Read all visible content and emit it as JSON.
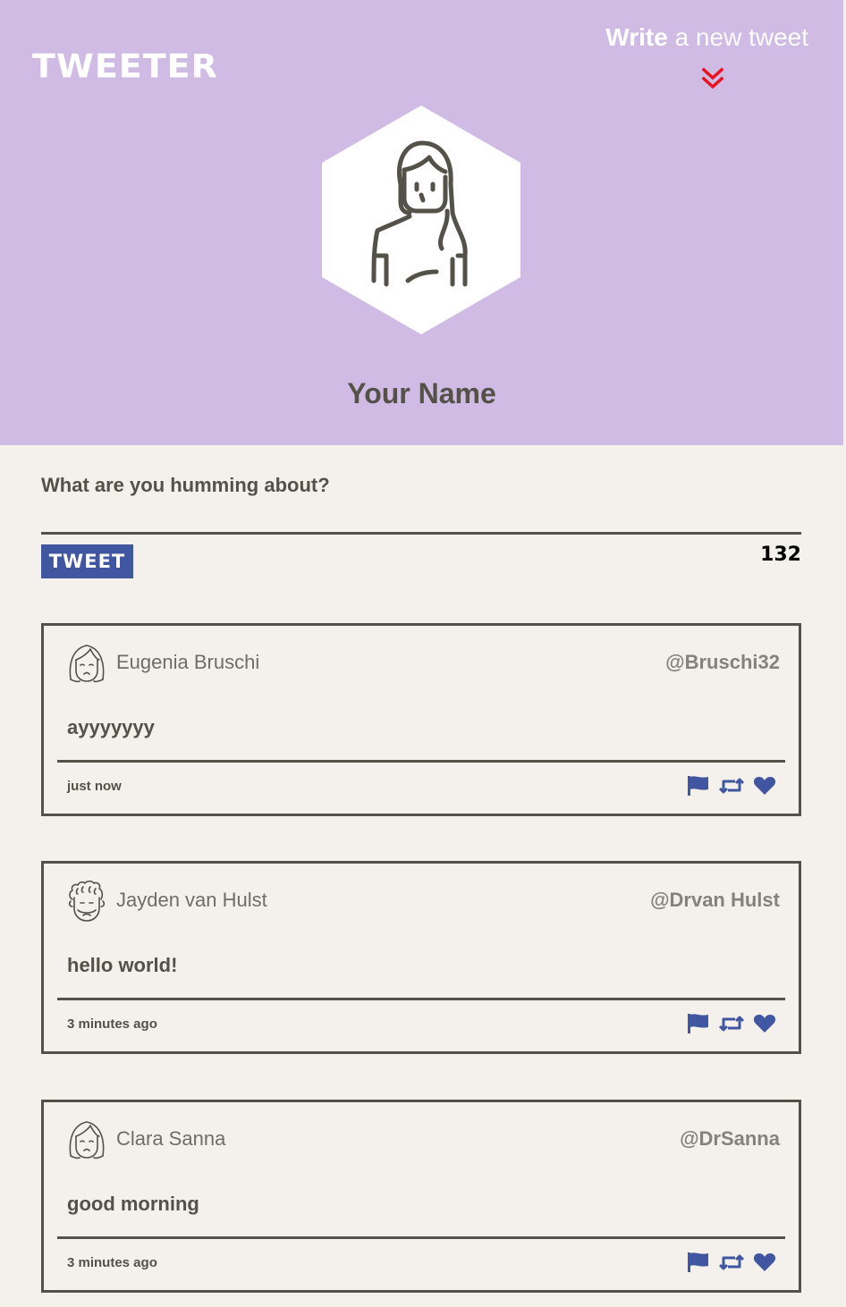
{
  "header": {
    "logo": "TWEETER",
    "compose_strong": "Write",
    "compose_light": "a new tweet",
    "chevron_icon": "double-chevron-down-icon",
    "chevron_color": "#e8131e",
    "avatar_icon": "woman-avatar-icon",
    "profile_name": "Your Name",
    "background": "#cfbbe4"
  },
  "composer": {
    "placeholder": "What are you humming about?",
    "button_label": "TWEET",
    "char_count": "132",
    "accent": "#4056a1"
  },
  "tweets": [
    {
      "avatar_icon": "woman-avatar-icon",
      "name": "Eugenia Bruschi",
      "handle": "@Bruschi32",
      "content": "ayyyyyyy",
      "time": "just now",
      "actions": [
        "flag-icon",
        "retweet-icon",
        "heart-icon"
      ]
    },
    {
      "avatar_icon": "curly-hair-man-avatar-icon",
      "name": "Jayden van Hulst",
      "handle": "@Drvan Hulst",
      "content": "hello world!",
      "time": "3 minutes ago",
      "actions": [
        "flag-icon",
        "retweet-icon",
        "heart-icon"
      ]
    },
    {
      "avatar_icon": "woman-avatar-icon",
      "name": "Clara Sanna",
      "handle": "@DrSanna",
      "content": "good morning",
      "time": "3 minutes ago",
      "actions": [
        "flag-icon",
        "retweet-icon",
        "heart-icon"
      ]
    }
  ]
}
